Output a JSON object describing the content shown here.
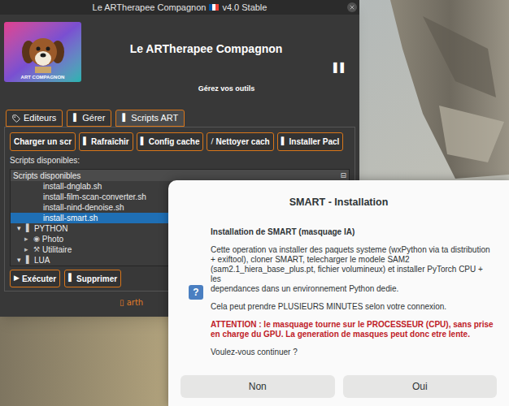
{
  "window": {
    "title": "Le ARTherapee Compagnon",
    "version": "v4.0 Stable"
  },
  "header": {
    "logo_text": "ART COMPAGNON",
    "title": "Le ARTherapee Compagnon",
    "toggle": "▐▐",
    "subtitle": "Gérez vos outils"
  },
  "tabs": [
    {
      "kind": "tag",
      "label": "Editeurs",
      "selected": false
    },
    {
      "kind": "glyph",
      "glyph": "▌",
      "label": "Gérer",
      "selected": false
    },
    {
      "kind": "glyph",
      "glyph": "▌",
      "label": "Scripts ART",
      "selected": true
    }
  ],
  "toolbar": [
    {
      "label": "Charger un scr"
    },
    {
      "glyph": "▌",
      "label": "Rafraîchir"
    },
    {
      "glyph": "▌",
      "label": "Config cache"
    },
    {
      "glyph": "/",
      "label": "Nettoyer cach"
    },
    {
      "glyph": "▌",
      "label": "Installer Pacl"
    }
  ],
  "scripts_label": "Scripts disponibles:",
  "tree": {
    "header": "Scripts disponibles",
    "collapse": "⊟",
    "rows": [
      {
        "kind": "script",
        "label": "install-dnglab.sh",
        "selected": false
      },
      {
        "kind": "script",
        "label": "install-film-scan-converter.sh",
        "selected": false
      },
      {
        "kind": "script",
        "label": "install-nind-denoise.sh",
        "selected": false
      },
      {
        "kind": "script",
        "label": "install-smart.sh",
        "selected": true
      },
      {
        "kind": "category",
        "arrow": "▾",
        "glyph": "▌",
        "label": "PYTHON",
        "expanded": true,
        "selected": false
      },
      {
        "kind": "folder",
        "arrow": "▸",
        "glyph": "◉",
        "label": "Photo",
        "expanded": false,
        "selected": false
      },
      {
        "kind": "folder",
        "arrow": "▸",
        "glyph": "⚒",
        "label": "Utilitaire",
        "expanded": false,
        "selected": false
      },
      {
        "kind": "category",
        "arrow": "▾",
        "glyph": "▌",
        "label": "LUA",
        "expanded": true,
        "selected": false
      }
    ]
  },
  "actions": [
    {
      "glyph": "▶",
      "label": "Exécuter"
    },
    {
      "glyph": "▌",
      "label": "Supprimer"
    }
  ],
  "footer": "▯ arth",
  "dialog": {
    "title": "SMART - Installation",
    "icon": "?",
    "heading": "Installation de SMART (masquage IA)",
    "paragraphs": [
      "Cette operation va installer des paquets systeme (wxPython via ta distribution + exiftool), cloner SMART, telecharger le modele SAM2 (sam2.1_hiera_base_plus.pt, fichier volumineux) et installer PyTorch CPU + les\ndependances dans un environnement Python dedie.",
      "Cela peut prendre PLUSIEURS MINUTES selon votre connexion."
    ],
    "warning": "ATTENTION : le masquage tourne sur le PROCESSEUR (CPU), sans prise en charge du GPU. La generation de masques peut donc etre lente.",
    "question": "Voulez-vous continuer ?",
    "buttons": [
      {
        "label": "Non"
      },
      {
        "label": "Oui"
      }
    ]
  }
}
